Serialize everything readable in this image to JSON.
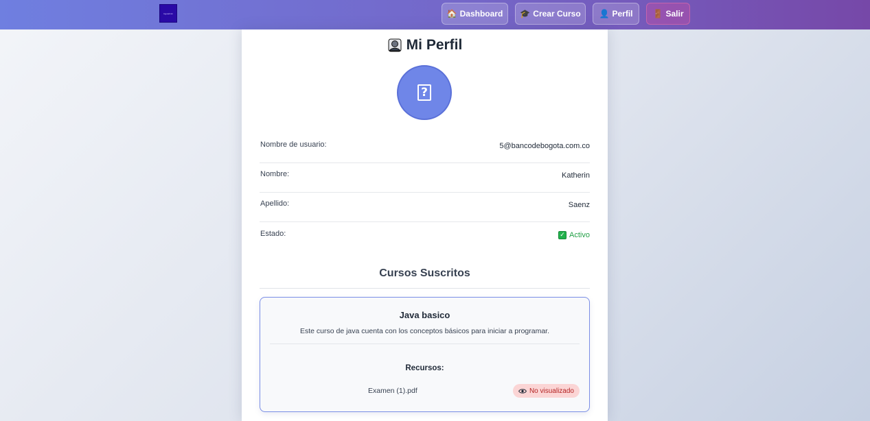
{
  "navbar": {
    "logo_text": "logoadmin",
    "buttons": [
      {
        "icon": "house-icon",
        "glyph": "🏠",
        "label": "Dashboard"
      },
      {
        "icon": "graduation-cap-icon",
        "glyph": "🎓",
        "label": "Crear Curso"
      },
      {
        "icon": "person-icon",
        "glyph": "👤",
        "label": "Perfil"
      },
      {
        "icon": "door-icon",
        "glyph": "🚪",
        "label": "Salir"
      }
    ]
  },
  "profile": {
    "title": "Mi Perfil",
    "avatar_glyph": "?",
    "fields": [
      {
        "label": "Nombre de usuario:",
        "value": "5@bancodebogota.com.co"
      },
      {
        "label": "Nombre:",
        "value": "Katherin"
      },
      {
        "label": "Apellido:",
        "value": "Saenz"
      },
      {
        "label": "Estado:",
        "value": "Activo",
        "check": "✓"
      }
    ]
  },
  "courses": {
    "section_title": "Cursos Suscritos",
    "items": [
      {
        "title": "Java basico",
        "description": "Este curso de java cuenta con los conceptos básicos para iniciar a programar.",
        "resources_title": "Recursos:",
        "resources": [
          {
            "name": "Examen (1).pdf",
            "status": "No visualizado"
          }
        ]
      }
    ]
  },
  "colors": {
    "accent": "#6f86e8",
    "status_active": "#22a046",
    "status_unviewed_bg": "#fbd5d5",
    "status_unviewed_text": "#b42323"
  }
}
